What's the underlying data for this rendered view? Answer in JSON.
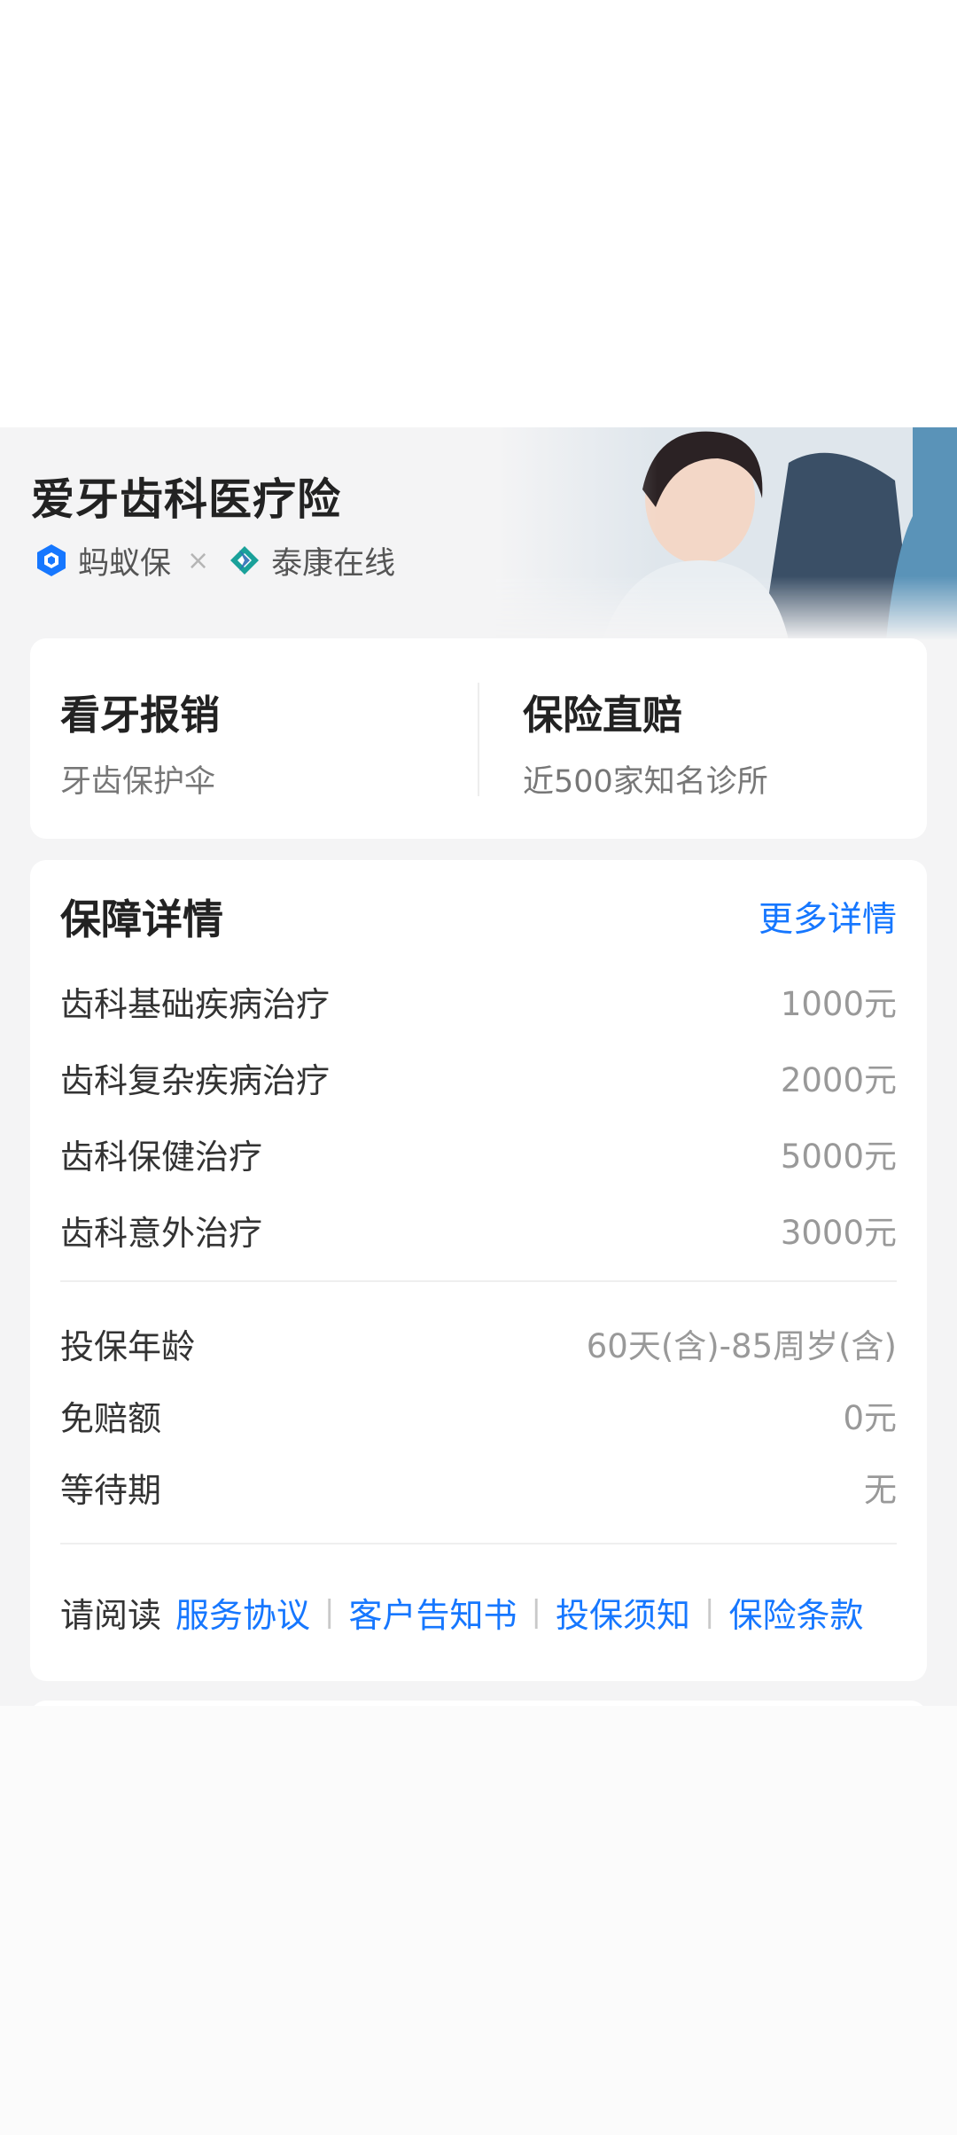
{
  "product": {
    "title": "爱牙齿科医疗险",
    "brand_primary": "蚂蚁保",
    "brand_separator": "×",
    "brand_partner": "泰康在线"
  },
  "features": [
    {
      "title": "看牙报销",
      "subtitle": "牙齿保护伞"
    },
    {
      "title": "保险直赔",
      "subtitle": "近500家知名诊所"
    }
  ],
  "coverage": {
    "title": "保障详情",
    "more_link": "更多详情",
    "items": [
      {
        "label": "齿科基础疾病治疗",
        "value": "1000元"
      },
      {
        "label": "齿科复杂疾病治疗",
        "value": "2000元"
      },
      {
        "label": "齿科保健治疗",
        "value": "5000元"
      },
      {
        "label": "齿科意外治疗",
        "value": "3000元"
      }
    ],
    "terms": [
      {
        "label": "投保年龄",
        "value": "60天(含)-85周岁(含)"
      },
      {
        "label": "免赔额",
        "value": "0元"
      },
      {
        "label": "等待期",
        "value": "无"
      }
    ],
    "read_prefix": "请阅读",
    "documents": [
      "服务协议",
      "客户告知书",
      "投保须知",
      "保险条款"
    ]
  },
  "colors": {
    "link_blue": "#1677ff",
    "panel_bg": "#f4f4f5",
    "card_bg": "#ffffff",
    "ant_blue": "#1677ff",
    "taikang_teal": "#1aa19a"
  }
}
